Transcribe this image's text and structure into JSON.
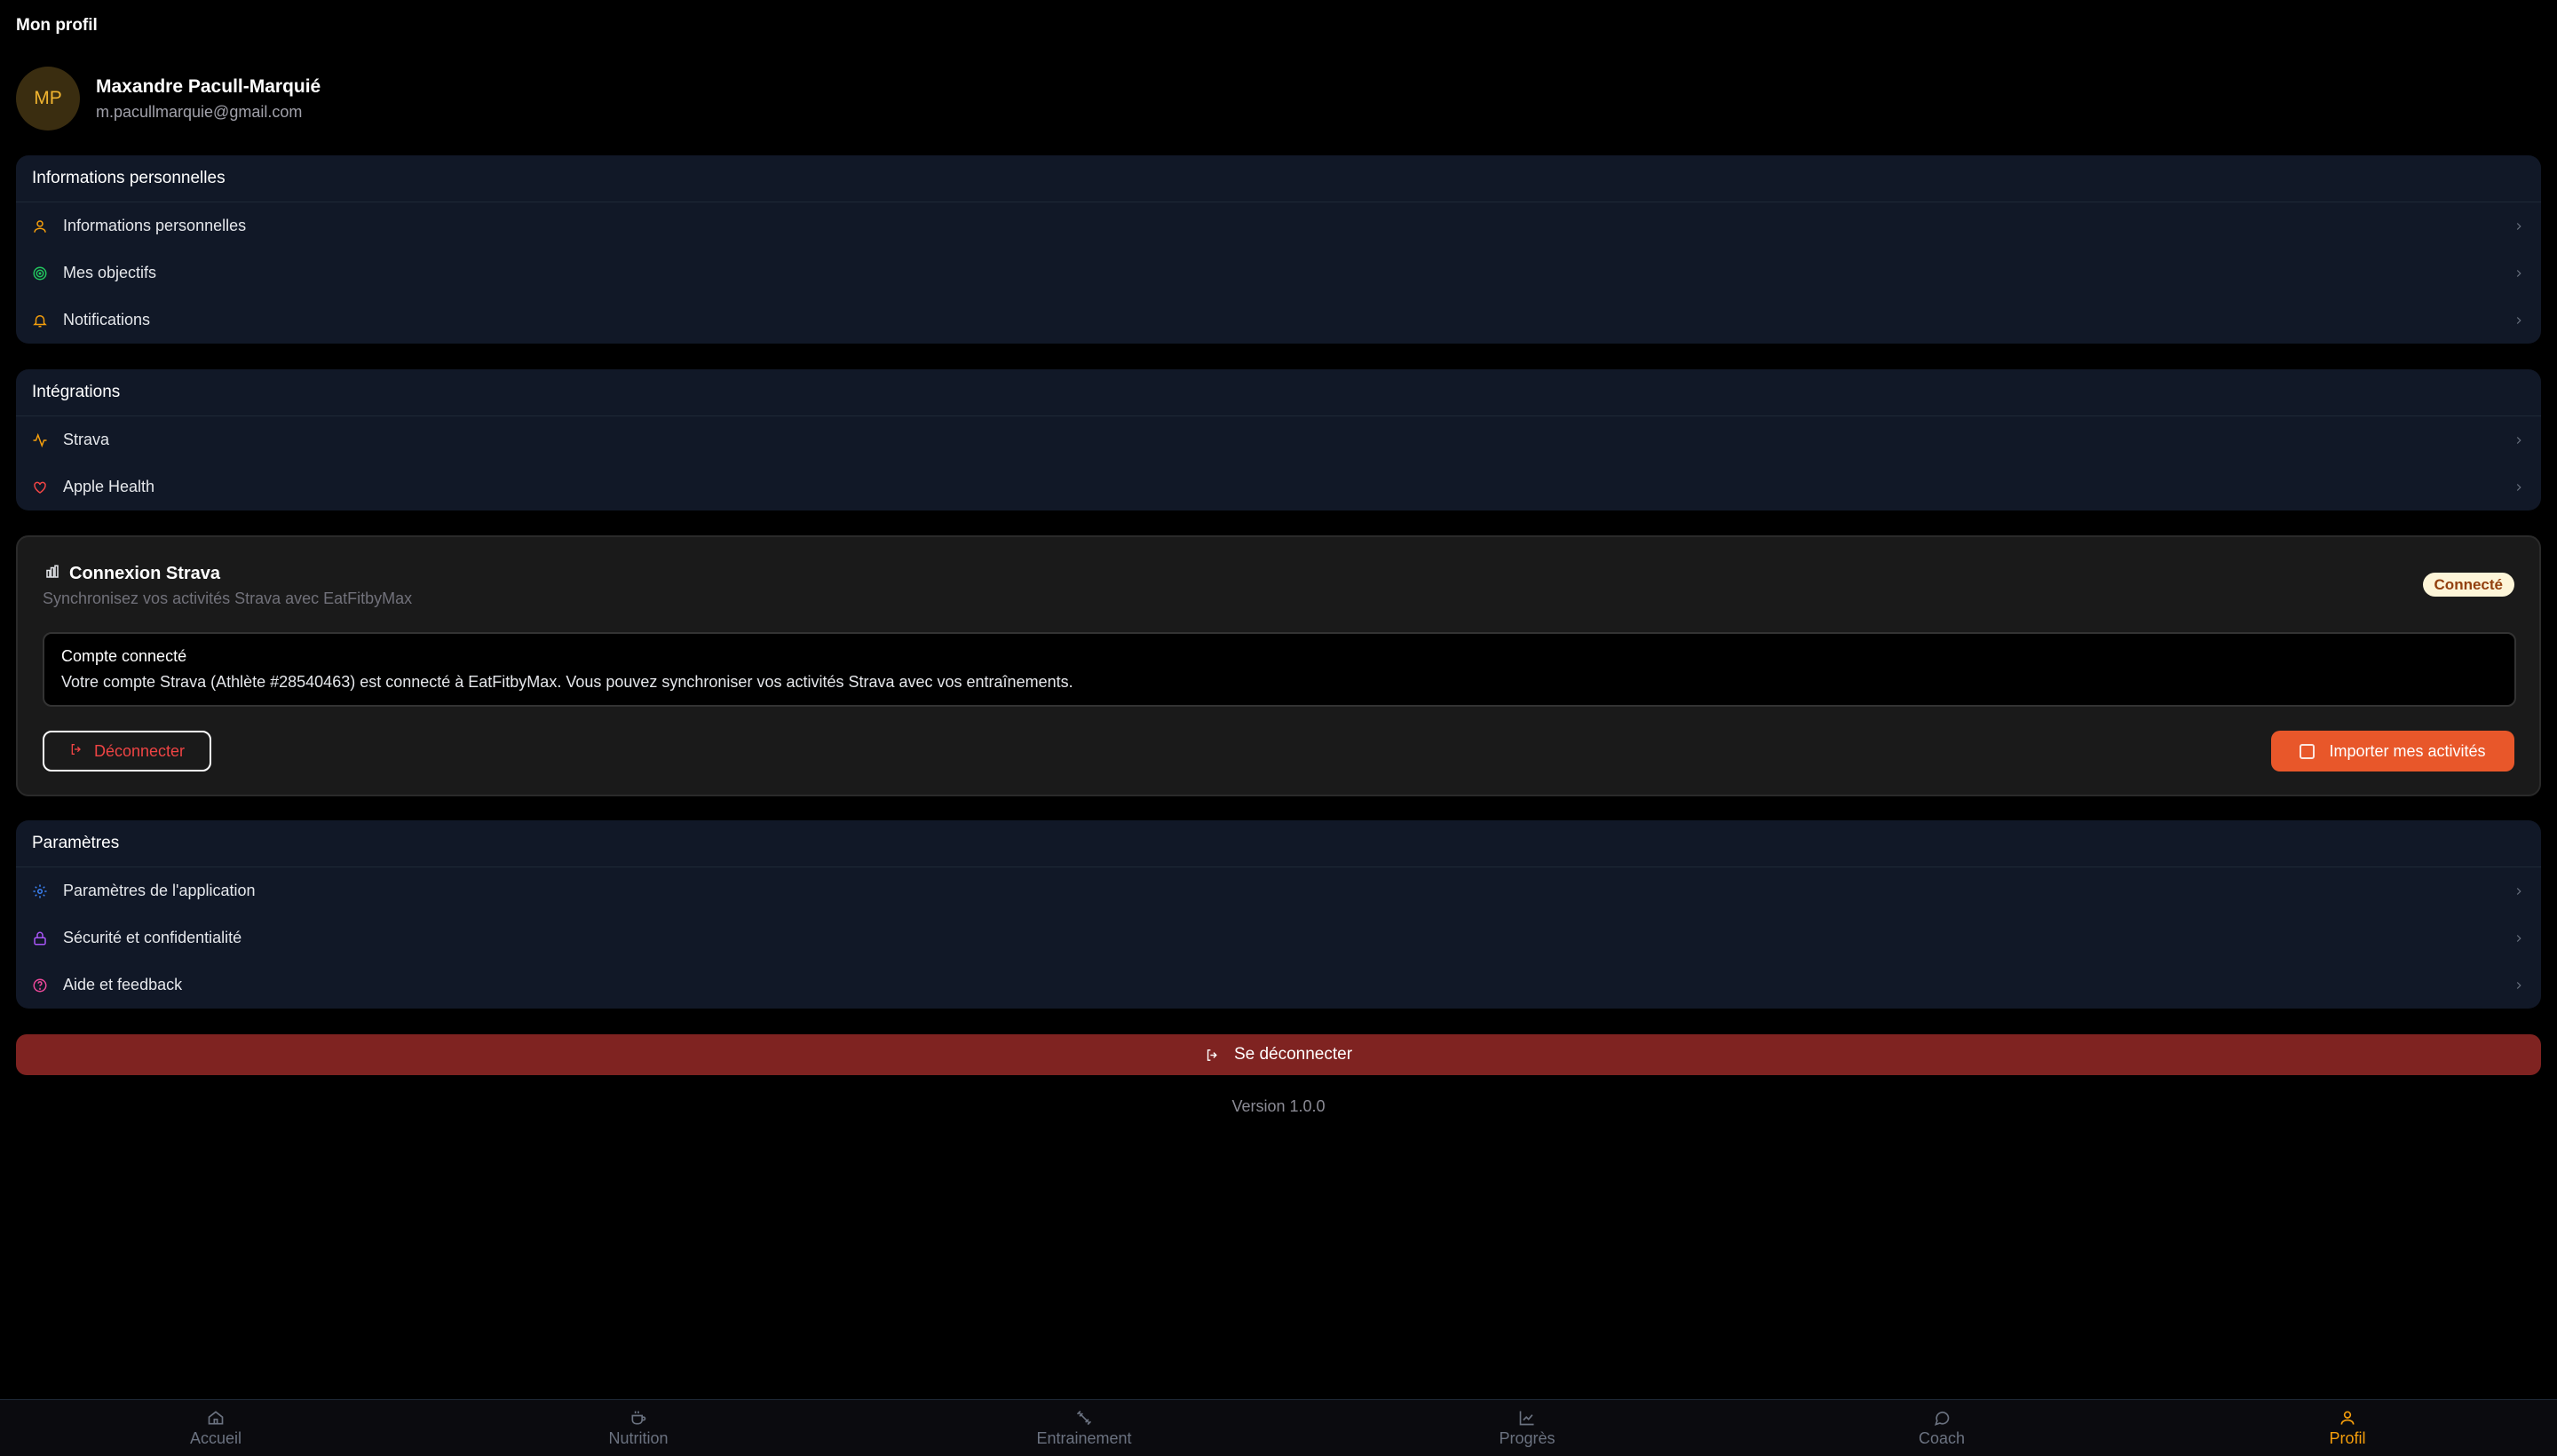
{
  "page": {
    "title": "Mon profil"
  },
  "profile": {
    "initials": "MP",
    "name": "Maxandre Pacull-Marquié",
    "email": "m.pacullmarquie@gmail.com"
  },
  "personal": {
    "header": "Informations personnelles",
    "items": [
      {
        "label": "Informations personnelles",
        "icon": "user-icon",
        "color": "#f59e0b"
      },
      {
        "label": "Mes objectifs",
        "icon": "target-icon",
        "color": "#22c55e"
      },
      {
        "label": "Notifications",
        "icon": "bell-icon",
        "color": "#f59e0b"
      }
    ]
  },
  "integrations": {
    "header": "Intégrations",
    "items": [
      {
        "label": "Strava",
        "icon": "activity-icon",
        "color": "#f59e0b"
      },
      {
        "label": "Apple Health",
        "icon": "heart-icon",
        "color": "#ef4444"
      }
    ]
  },
  "strava": {
    "title": "Connexion Strava",
    "subtitle": "Synchronisez vos activités Strava avec EatFitbyMax",
    "badge": "Connecté",
    "alert_title": "Compte connecté",
    "alert_body": "Votre compte Strava (Athlète #28540463) est connecté à EatFitbyMax. Vous pouvez synchroniser vos activités Strava avec vos entraînements.",
    "disconnect_label": "Déconnecter",
    "import_label": "Importer mes activités"
  },
  "settings": {
    "header": "Paramètres",
    "items": [
      {
        "label": "Paramètres de l'application",
        "icon": "gear-icon",
        "color": "#3b82f6"
      },
      {
        "label": "Sécurité et confidentialité",
        "icon": "lock-icon",
        "color": "#a855f7"
      },
      {
        "label": "Aide et feedback",
        "icon": "help-circle-icon",
        "color": "#ec4899"
      }
    ]
  },
  "logout": {
    "label": "Se déconnecter"
  },
  "version": "Version 1.0.0",
  "nav": {
    "items": [
      {
        "label": "Accueil",
        "icon": "home-icon"
      },
      {
        "label": "Nutrition",
        "icon": "cup-icon"
      },
      {
        "label": "Entrainement",
        "icon": "dumbbell-icon"
      },
      {
        "label": "Progrès",
        "icon": "chart-icon"
      },
      {
        "label": "Coach",
        "icon": "message-icon"
      },
      {
        "label": "Profil",
        "icon": "user-icon"
      }
    ],
    "active": "Profil",
    "active_color": "#f59e0b"
  }
}
